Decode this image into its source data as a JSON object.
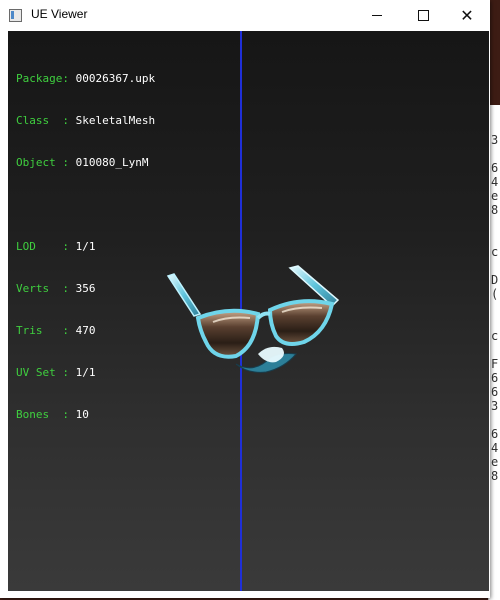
{
  "window": {
    "title": "UE Viewer",
    "minimize_glyph": "minimize",
    "maximize_glyph": "maximize",
    "close_glyph": "✕"
  },
  "info_panel": {
    "package": {
      "label": "Package:",
      "value": "00026367.upk"
    },
    "class": {
      "label": "Class  :",
      "value": "SkeletalMesh"
    },
    "object": {
      "label": "Object :",
      "value": "010080_LynM"
    },
    "lod": {
      "label": "LOD    :",
      "value": "1/1"
    },
    "verts": {
      "label": "Verts  :",
      "value": "356"
    },
    "tris": {
      "label": "Tris   :",
      "value": "470"
    },
    "uvset": {
      "label": "UV Set :",
      "value": "1/1"
    },
    "bones": {
      "label": "Bones  :",
      "value": "10"
    }
  },
  "background_app": {
    "text_fragments": "3\n\n6\n4\ne\n8\n\n\nc\n\nD\n(\n\n\nc\n\nF\n6\n6\n3\n\n6\n4\ne\n8"
  },
  "colors": {
    "label": "#3fcf3f",
    "value": "#ffffff",
    "axis": "#1f2fd8",
    "viewport_top": "#161616",
    "viewport_bottom": "#3a3a3a"
  },
  "viewport_model": {
    "name": "sunglasses-mesh"
  }
}
